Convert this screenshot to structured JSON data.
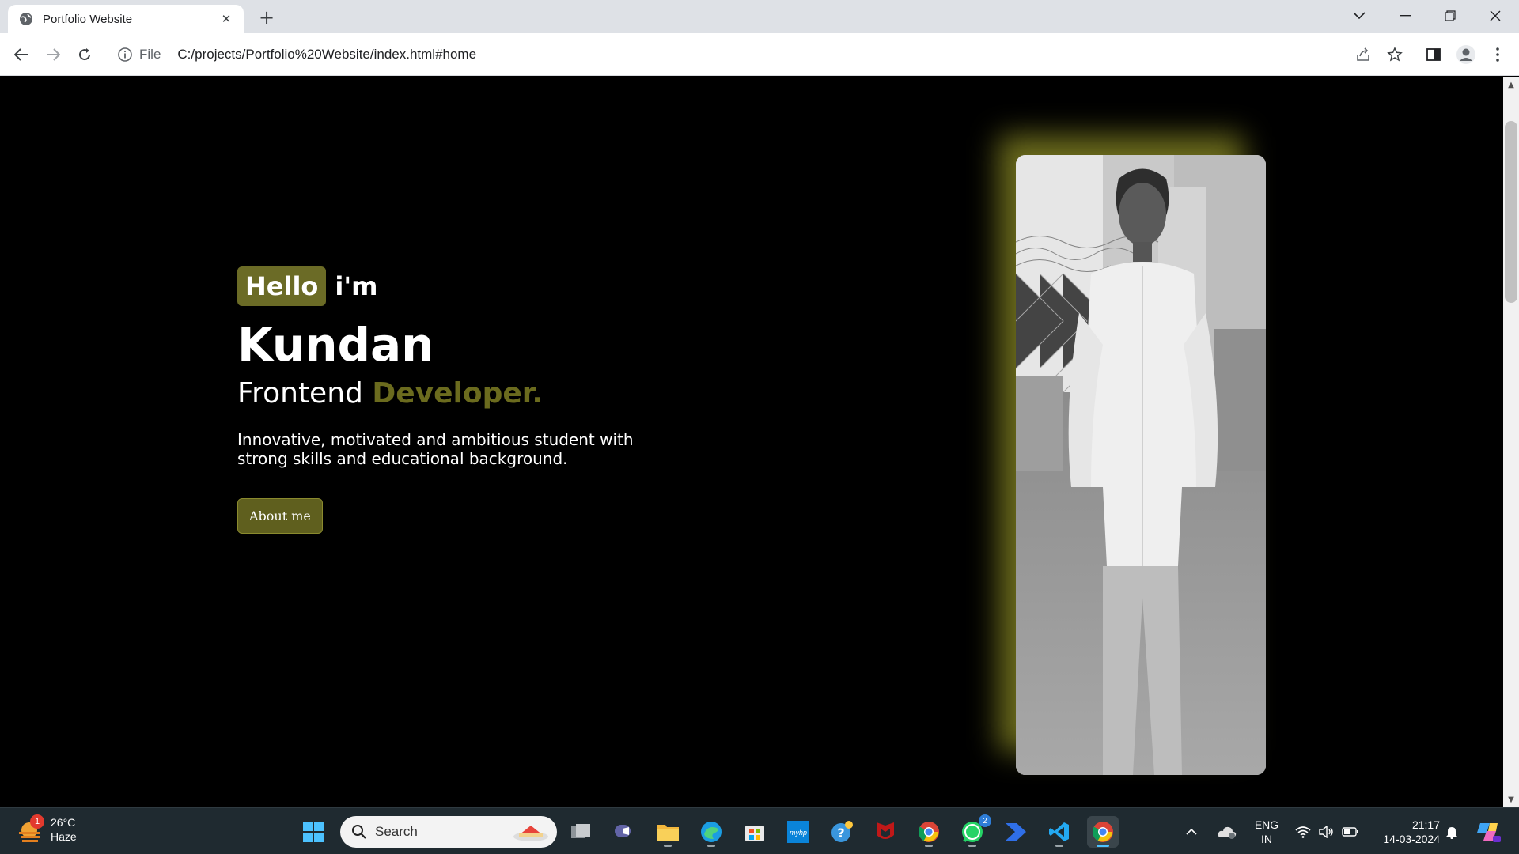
{
  "browser": {
    "tab_title": "Portfolio Website",
    "address_scheme": "File",
    "address_url": "C:/projects/Portfolio%20Website/index.html#home"
  },
  "hero": {
    "hello": "Hello",
    "im": "i'm",
    "name": "Kundan",
    "role_plain": "Frontend",
    "role_accent": "Developer.",
    "description": "Innovative, motivated and ambitious student with strong skills and educational background.",
    "button_label": "About me",
    "accent_color": "#6b6b1e",
    "photo_alt": "Portrait photo of Kundan"
  },
  "taskbar": {
    "weather_temp": "26°C",
    "weather_desc": "Haze",
    "weather_badge": "1",
    "search_label": "Search",
    "whatsapp_badge": "2",
    "lang_primary": "ENG",
    "lang_secondary": "IN",
    "time": "21:17",
    "date": "14-03-2024"
  }
}
